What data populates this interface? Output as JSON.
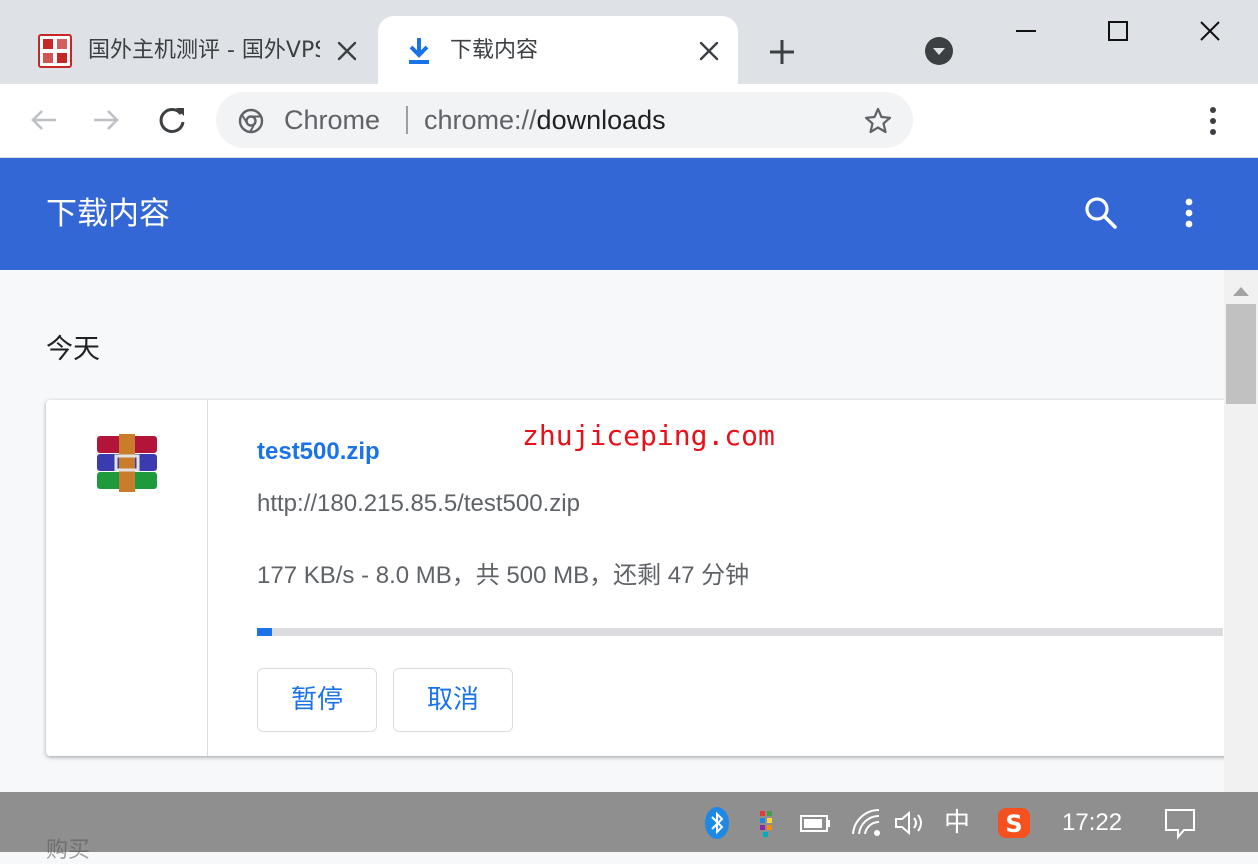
{
  "tabs": [
    {
      "title": "国外主机测评 - 国外VPS",
      "favicon": "site-seal-icon",
      "active": false
    },
    {
      "title": "下载内容",
      "favicon": "download-arrow-icon",
      "active": true
    }
  ],
  "toolbar": {
    "omnibox_chip": "Chrome",
    "url_scheme": "chrome://",
    "url_host": "downloads"
  },
  "downloads_page": {
    "title": "下载内容",
    "date_heading": "今天",
    "items": [
      {
        "file_name": "test500.zip",
        "url": "http://180.215.85.5/test500.zip",
        "status": "177 KB/s - 8.0 MB，共 500 MB，还剩 47 分钟",
        "progress_fraction": 0.016,
        "file_icon": "winrar-archive-icon",
        "pause_label": "暂停",
        "cancel_label": "取消"
      }
    ]
  },
  "watermark": "zhujiceping.com",
  "taskbar": {
    "ghost_text": "购买",
    "ime": "中",
    "clock": "17:22"
  },
  "colors": {
    "header_blue": "#3367d6",
    "link_blue": "#1a73e8",
    "watermark_red": "#e8101a"
  }
}
